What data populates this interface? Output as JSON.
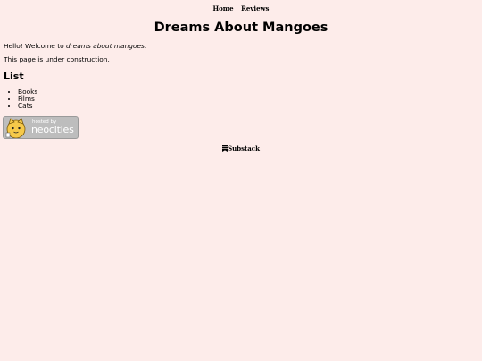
{
  "nav": {
    "home_label": "Home",
    "reviews_label": "Reviews"
  },
  "page": {
    "title": "Dreams About Mangoes",
    "greeting_prefix": "Hello! Welcome to ",
    "greeting_emphasis": "dreams about mangoes",
    "greeting_suffix": ".",
    "construction_text": "This page is under construction.",
    "list_heading": "List",
    "list_items": [
      "Books",
      "Films",
      "Cats"
    ]
  },
  "badge": {
    "line1": "hosted by",
    "line2": "neocities"
  },
  "footer": {
    "substack_icon": "bookmark-icon",
    "substack_label": "Substack"
  },
  "colors": {
    "background": "#fdecea",
    "badge_bg": "#bdbdbd"
  }
}
